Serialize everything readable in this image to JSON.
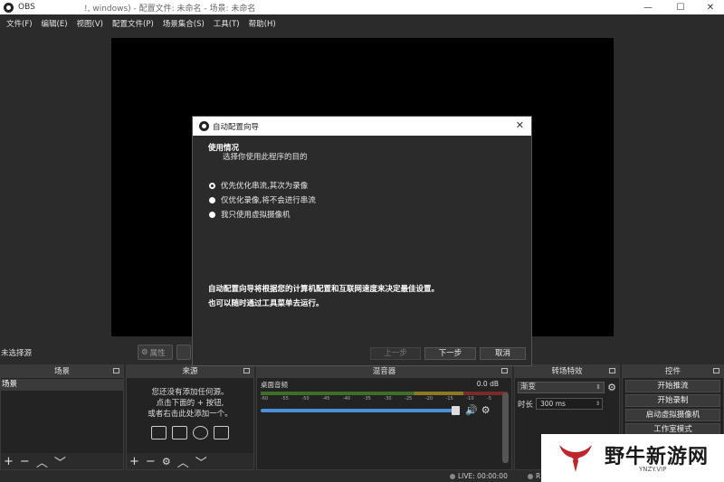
{
  "window": {
    "app_name": "OBS",
    "title": "!, windows) - 配置文件: 未命名 - 场景: 未命名",
    "minimize": "—",
    "maximize": "☐",
    "close": "✕"
  },
  "menu": [
    "文件(F)",
    "编辑(E)",
    "视图(V)",
    "配置文件(P)",
    "场景集合(S)",
    "工具(T)",
    "帮助(H)"
  ],
  "source_toolbar": {
    "no_source": "未选择源",
    "properties": "属性"
  },
  "docks": {
    "scenes": {
      "title": "场景",
      "items": [
        "场景"
      ]
    },
    "sources": {
      "title": "来源",
      "empty_lines": [
        "您还没有添加任何源。",
        "点击下面的 + 按钮,",
        "或者右击此处添加一个。"
      ]
    },
    "mixer": {
      "title": "混音器",
      "track_name": "桌面音频",
      "track_level": "0.0 dB",
      "scale": [
        "-60",
        "-55",
        "-50",
        "-45",
        "-40",
        "-35",
        "-30",
        "-25",
        "-20",
        "-15",
        "-10",
        "-5",
        "0"
      ]
    },
    "transitions": {
      "title": "转场特效",
      "selected": "渐变",
      "duration_label": "时长",
      "duration_value": "300 ms"
    },
    "controls": {
      "title": "控件",
      "buttons": [
        "开始推流",
        "开始录制",
        "启动虚拟摄像机",
        "工作室模式"
      ]
    }
  },
  "statusbar": {
    "live": "LIVE: 00:00:00",
    "rec": "REC"
  },
  "dialog": {
    "title": "自动配置向导",
    "heading": "使用情况",
    "subheading": "选择你使用此程序的目的",
    "options": [
      {
        "label": "优先优化串流,其次为录像",
        "checked": true
      },
      {
        "label": "仅优化录像,将不会进行串流",
        "checked": false
      },
      {
        "label": "我只使用虚拟摄像机",
        "checked": false
      }
    ],
    "desc_line1": "自动配置向导将根据您的计算机配置和互联网速度来决定最佳设置。",
    "desc_line2": "也可以随时通过工具菜单去运行。",
    "btn_prev": "上一步",
    "btn_next": "下一步",
    "btn_cancel": "取消"
  },
  "watermark": {
    "text": "野牛新游网",
    "sub": "YNZY.VIP"
  },
  "icons": {
    "app": "obs-logo-icon",
    "gear": "gear-icon",
    "speaker": "speaker-icon"
  },
  "colors": {
    "bg": "#2b2b2b",
    "panel": "#232323",
    "accent": "#4a90d9",
    "watermark_red": "#c0262d"
  }
}
